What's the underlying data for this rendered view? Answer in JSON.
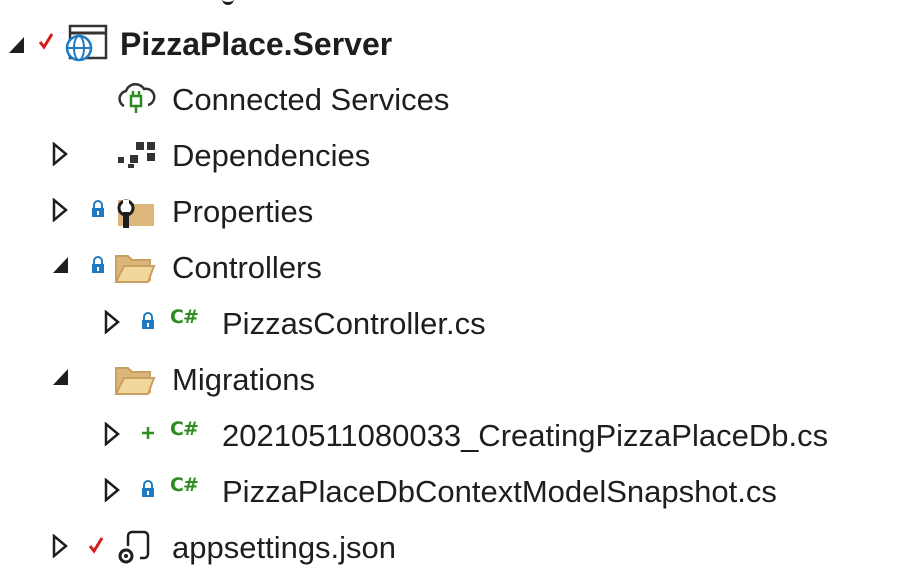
{
  "tree": {
    "items": [
      {
        "label": "PizzaPlace.Server",
        "icon": "web-project-icon",
        "state": "checked",
        "expander": "expanded"
      },
      {
        "label": "Connected Services",
        "icon": "connected-services-icon",
        "state": "",
        "expander": "none"
      },
      {
        "label": "Dependencies",
        "icon": "dependencies-icon",
        "state": "",
        "expander": "collapsed"
      },
      {
        "label": "Properties",
        "icon": "properties-folder-icon",
        "state": "locked",
        "expander": "collapsed"
      },
      {
        "label": "Controllers",
        "icon": "folder-icon",
        "state": "locked",
        "expander": "expanded"
      },
      {
        "label": "PizzasController.cs",
        "icon": "csharp-file-icon",
        "state": "locked",
        "expander": "collapsed"
      },
      {
        "label": "Migrations",
        "icon": "folder-icon",
        "state": "",
        "expander": "expanded"
      },
      {
        "label": "20210511080033_CreatingPizzaPlaceDb.cs",
        "icon": "csharp-file-icon",
        "state": "added",
        "expander": "collapsed"
      },
      {
        "label": "PizzaPlaceDbContextModelSnapshot.cs",
        "icon": "csharp-file-icon",
        "state": "locked",
        "expander": "collapsed"
      },
      {
        "label": "appsettings.json",
        "icon": "json-file-icon",
        "state": "checked",
        "expander": "collapsed"
      }
    ],
    "csharp_glyph": "C#"
  },
  "colors": {
    "check": "#d41c1c",
    "lock": "#1f7bc1",
    "added": "#2e8b20",
    "folder": "#dcb67a",
    "text": "#1e1e1e"
  }
}
